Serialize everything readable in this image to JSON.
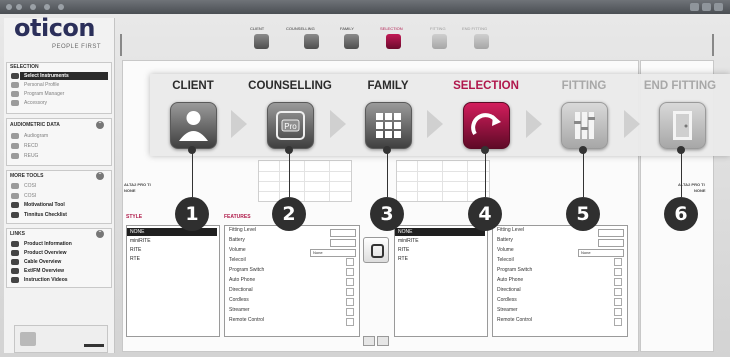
{
  "sidebar": {
    "logo": "oticon",
    "logo_tagline": "PEOPLE FIRST",
    "selection": {
      "title": "SELECTION",
      "items": [
        "Select Instruments",
        "Personal Profile",
        "Program Manager",
        "Accessory"
      ]
    },
    "audiometric": {
      "title": "AUDIOMETRIC DATA",
      "items": [
        "Audiogram",
        "RECD",
        "REUG"
      ]
    },
    "more_tools": {
      "title": "MORE TOOLS",
      "items": [
        "COSI",
        "COSI",
        "Motivational Tool",
        "Tinnitus Checklist"
      ]
    },
    "links": {
      "title": "LINKS",
      "items": [
        "Product Information",
        "Product Overview",
        "Cable Overview",
        "Ext/FM Overview",
        "Instruction Videos"
      ]
    }
  },
  "workflow_small": [
    "CLIENT",
    "COUNSELLING",
    "FAMILY",
    "SELECTION",
    "FITTING",
    "END FITTING"
  ],
  "panel": {
    "device_left": "ALTA2 PRO TI",
    "device_left_sub": "NONE",
    "device_right": "ALTA2 PRO TI",
    "device_right_sub": "NONE",
    "style_header": "STYLE",
    "features_header": "FEATURES",
    "style_rows": [
      "NONE",
      "miniRITE",
      "RITE",
      "RTE"
    ],
    "features_rows": [
      "Fitting Level",
      "Battery",
      "Volume",
      "Telecoil",
      "Program Switch",
      "Auto Phone",
      "Directional",
      "Cordless",
      "Streamer",
      "Remote Control"
    ],
    "dropdown_none": "None"
  },
  "banner": {
    "steps": [
      {
        "label": "CLIENT",
        "color": "#2b2b2b",
        "badge": "1"
      },
      {
        "label": "COUNSELLING",
        "color": "#2b2b2b",
        "badge": "2"
      },
      {
        "label": "FAMILY",
        "color": "#2b2b2b",
        "badge": "3"
      },
      {
        "label": "SELECTION",
        "color": "#b0174c",
        "badge": "4"
      },
      {
        "label": "FITTING",
        "color": "#a8a8a8",
        "badge": "5"
      },
      {
        "label": "END FITTING",
        "color": "#a8a8a8",
        "badge": "6"
      }
    ],
    "icons": [
      "person-icon",
      "pro-icon",
      "grid-icon",
      "refresh-arrow-icon",
      "sliders-icon",
      "door-exit-icon"
    ]
  },
  "colors": {
    "accent": "#b0174c",
    "dark": "#2f2f2f",
    "disabled": "#a8a8a8"
  }
}
